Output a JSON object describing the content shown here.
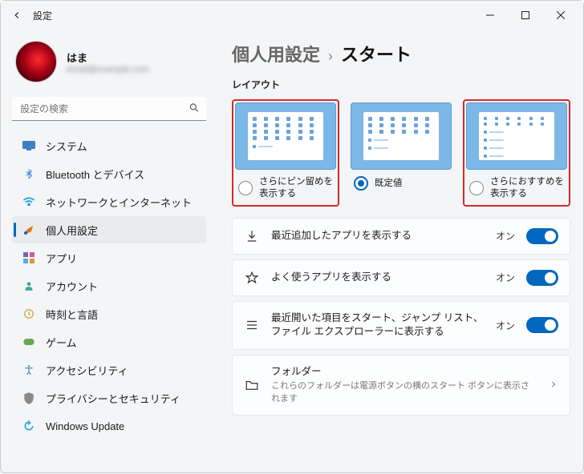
{
  "window": {
    "title": "設定"
  },
  "user": {
    "name": "はま",
    "email": "email@example.com"
  },
  "search": {
    "placeholder": "設定の検索"
  },
  "nav": {
    "system": "システム",
    "bluetooth": "Bluetooth とデバイス",
    "network": "ネットワークとインターネット",
    "personalization": "個人用設定",
    "apps": "アプリ",
    "accounts": "アカウント",
    "time": "時刻と言語",
    "gaming": "ゲーム",
    "accessibility": "アクセシビリティ",
    "privacy": "プライバシーとセキュリティ",
    "update": "Windows Update"
  },
  "breadcrumb": {
    "parent": "個人用設定",
    "current": "スタート"
  },
  "section": {
    "layout": "レイアウト"
  },
  "layout_options": {
    "more_pins": "さらにピン留めを表示する",
    "default": "既定値",
    "more_recs": "さらにおすすめを表示する"
  },
  "toggles": {
    "recent_apps": {
      "label": "最近追加したアプリを表示する",
      "value": "オン"
    },
    "most_used": {
      "label": "よく使うアプリを表示する",
      "value": "オン"
    },
    "recent_items": {
      "label": "最近開いた項目をスタート、ジャンプ リスト、ファイル エクスプローラーに表示する",
      "value": "オン"
    }
  },
  "folders": {
    "label": "フォルダー",
    "sub": "これらのフォルダーは電源ボタンの横のスタート ボタンに表示されます"
  }
}
